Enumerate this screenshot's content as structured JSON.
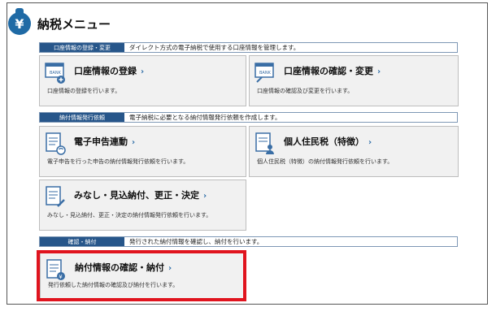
{
  "page": {
    "title": "納税メニュー"
  },
  "sections": {
    "account": {
      "label": "口座情報の登録・変更",
      "description": "ダイレクト方式の電子納税で使用する口座情報を管理します。",
      "cards": [
        {
          "title": "口座情報の登録",
          "description": "口座情報の登録を行います。",
          "icon": "bank-register-icon"
        },
        {
          "title": "口座情報の確認・変更",
          "description": "口座情報の確認及び変更を行います。",
          "icon": "bank-edit-icon"
        }
      ]
    },
    "request": {
      "label": "納付情報発行依頼",
      "description": "電子納税に必要となる納付情報発行依頼を作成します。",
      "cards": [
        {
          "title": "電子申告連動",
          "description": "電子申告を行った申告の納付情報発行依頼を行います。",
          "icon": "e-filing-link-icon"
        },
        {
          "title": "個人住民税（特徴）",
          "description": "個人住民税（特徴）の納付情報発行依頼を行います。",
          "icon": "resident-tax-icon"
        },
        {
          "title": "みなし・見込納付、更正・決定",
          "description": "みなし・見込納付、更正・決定の納付情報発行依頼を行います。",
          "icon": "deemed-payment-icon"
        }
      ]
    },
    "confirm": {
      "label": "確認・納付",
      "description": "発行された納付情報を確認し、納付を行います。",
      "cards": [
        {
          "title": "納付情報の確認・納付",
          "description": "発行依頼した納付情報の確認及び納付を行います。",
          "icon": "payment-confirm-icon"
        }
      ]
    }
  },
  "ui": {
    "chevron": "›",
    "yen": "¥",
    "bank": "BANK"
  },
  "colors": {
    "accent": "#27568a",
    "highlight": "#e0141e",
    "card_bg": "#f1f1f1"
  }
}
